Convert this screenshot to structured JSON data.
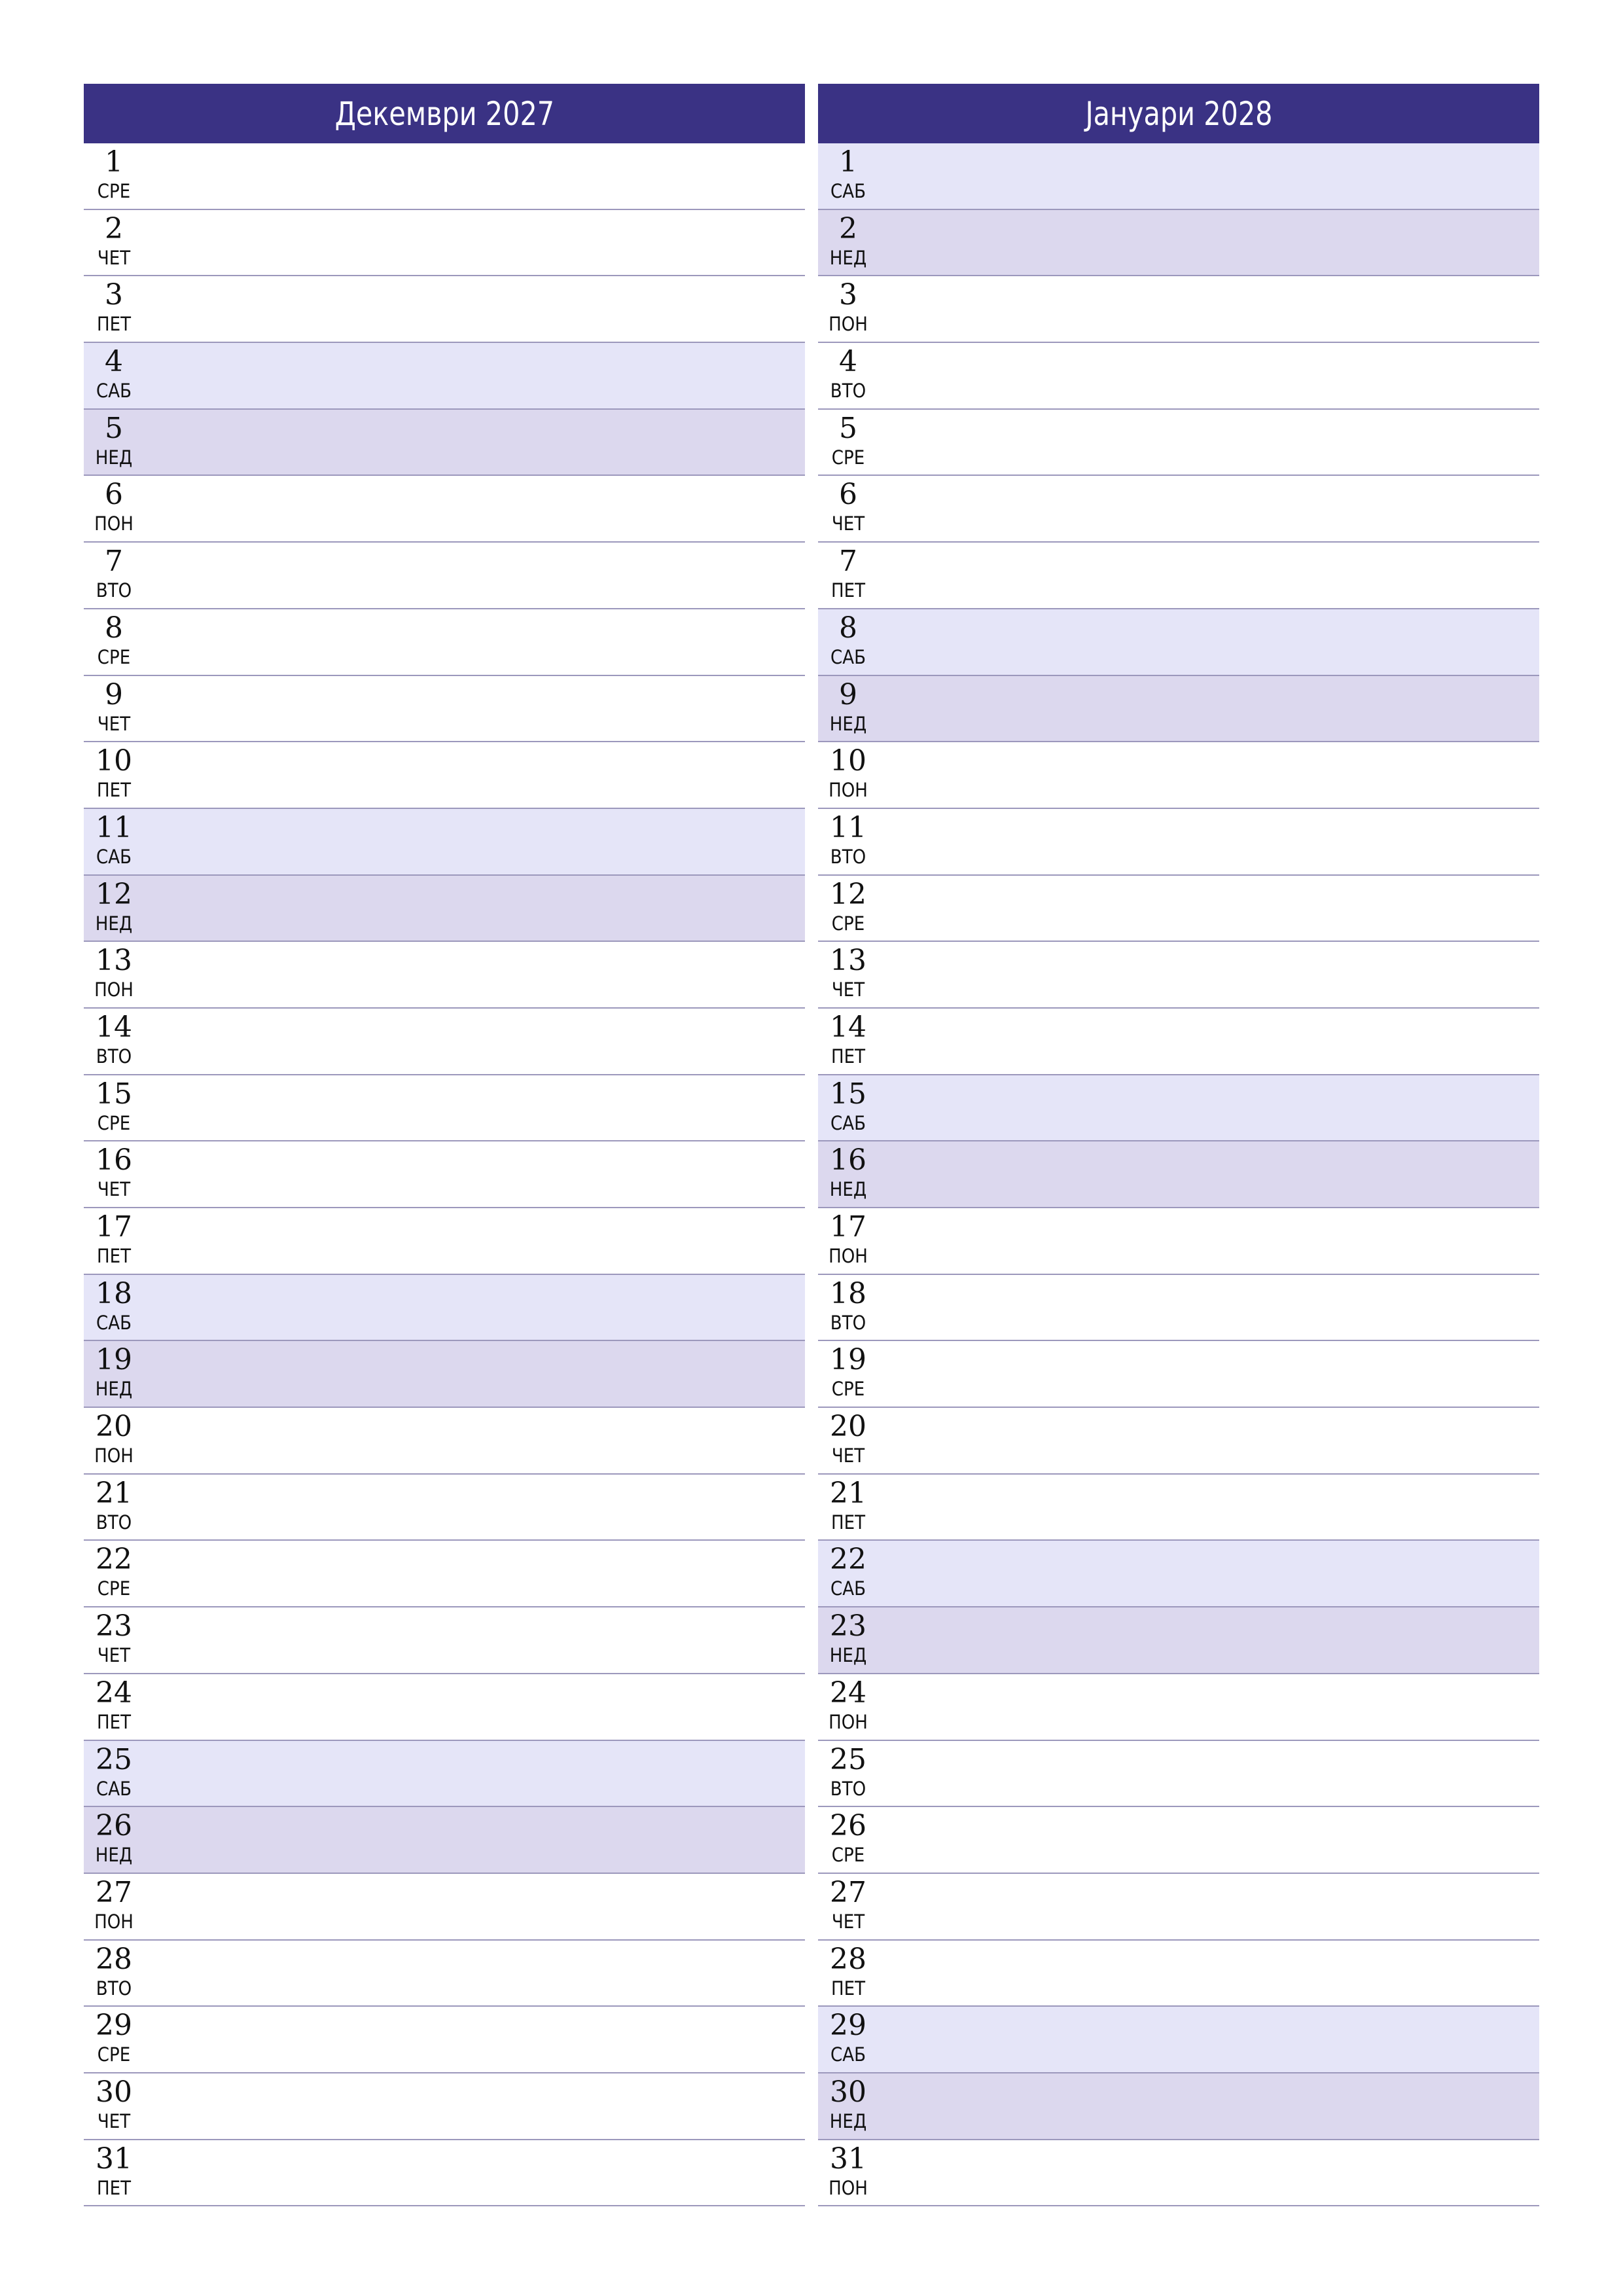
{
  "colors": {
    "header_bg": "#3A3284",
    "saturday_bg": "#E5E5F8",
    "sunday_bg": "#DCD8EE",
    "separator": "#9C98BC"
  },
  "months": [
    {
      "title": "Декември 2027",
      "days": [
        {
          "num": "1",
          "wd": "СРЕ",
          "type": "weekday"
        },
        {
          "num": "2",
          "wd": "ЧЕТ",
          "type": "weekday"
        },
        {
          "num": "3",
          "wd": "ПЕТ",
          "type": "weekday"
        },
        {
          "num": "4",
          "wd": "САБ",
          "type": "sat"
        },
        {
          "num": "5",
          "wd": "НЕД",
          "type": "sun"
        },
        {
          "num": "6",
          "wd": "ПОН",
          "type": "weekday"
        },
        {
          "num": "7",
          "wd": "ВТО",
          "type": "weekday"
        },
        {
          "num": "8",
          "wd": "СРЕ",
          "type": "weekday"
        },
        {
          "num": "9",
          "wd": "ЧЕТ",
          "type": "weekday"
        },
        {
          "num": "10",
          "wd": "ПЕТ",
          "type": "weekday"
        },
        {
          "num": "11",
          "wd": "САБ",
          "type": "sat"
        },
        {
          "num": "12",
          "wd": "НЕД",
          "type": "sun"
        },
        {
          "num": "13",
          "wd": "ПОН",
          "type": "weekday"
        },
        {
          "num": "14",
          "wd": "ВТО",
          "type": "weekday"
        },
        {
          "num": "15",
          "wd": "СРЕ",
          "type": "weekday"
        },
        {
          "num": "16",
          "wd": "ЧЕТ",
          "type": "weekday"
        },
        {
          "num": "17",
          "wd": "ПЕТ",
          "type": "weekday"
        },
        {
          "num": "18",
          "wd": "САБ",
          "type": "sat"
        },
        {
          "num": "19",
          "wd": "НЕД",
          "type": "sun"
        },
        {
          "num": "20",
          "wd": "ПОН",
          "type": "weekday"
        },
        {
          "num": "21",
          "wd": "ВТО",
          "type": "weekday"
        },
        {
          "num": "22",
          "wd": "СРЕ",
          "type": "weekday"
        },
        {
          "num": "23",
          "wd": "ЧЕТ",
          "type": "weekday"
        },
        {
          "num": "24",
          "wd": "ПЕТ",
          "type": "weekday"
        },
        {
          "num": "25",
          "wd": "САБ",
          "type": "sat"
        },
        {
          "num": "26",
          "wd": "НЕД",
          "type": "sun"
        },
        {
          "num": "27",
          "wd": "ПОН",
          "type": "weekday"
        },
        {
          "num": "28",
          "wd": "ВТО",
          "type": "weekday"
        },
        {
          "num": "29",
          "wd": "СРЕ",
          "type": "weekday"
        },
        {
          "num": "30",
          "wd": "ЧЕТ",
          "type": "weekday"
        },
        {
          "num": "31",
          "wd": "ПЕТ",
          "type": "weekday"
        }
      ]
    },
    {
      "title": "Јануари 2028",
      "days": [
        {
          "num": "1",
          "wd": "САБ",
          "type": "sat"
        },
        {
          "num": "2",
          "wd": "НЕД",
          "type": "sun"
        },
        {
          "num": "3",
          "wd": "ПОН",
          "type": "weekday"
        },
        {
          "num": "4",
          "wd": "ВТО",
          "type": "weekday"
        },
        {
          "num": "5",
          "wd": "СРЕ",
          "type": "weekday"
        },
        {
          "num": "6",
          "wd": "ЧЕТ",
          "type": "weekday"
        },
        {
          "num": "7",
          "wd": "ПЕТ",
          "type": "weekday"
        },
        {
          "num": "8",
          "wd": "САБ",
          "type": "sat"
        },
        {
          "num": "9",
          "wd": "НЕД",
          "type": "sun"
        },
        {
          "num": "10",
          "wd": "ПОН",
          "type": "weekday"
        },
        {
          "num": "11",
          "wd": "ВТО",
          "type": "weekday"
        },
        {
          "num": "12",
          "wd": "СРЕ",
          "type": "weekday"
        },
        {
          "num": "13",
          "wd": "ЧЕТ",
          "type": "weekday"
        },
        {
          "num": "14",
          "wd": "ПЕТ",
          "type": "weekday"
        },
        {
          "num": "15",
          "wd": "САБ",
          "type": "sat"
        },
        {
          "num": "16",
          "wd": "НЕД",
          "type": "sun"
        },
        {
          "num": "17",
          "wd": "ПОН",
          "type": "weekday"
        },
        {
          "num": "18",
          "wd": "ВТО",
          "type": "weekday"
        },
        {
          "num": "19",
          "wd": "СРЕ",
          "type": "weekday"
        },
        {
          "num": "20",
          "wd": "ЧЕТ",
          "type": "weekday"
        },
        {
          "num": "21",
          "wd": "ПЕТ",
          "type": "weekday"
        },
        {
          "num": "22",
          "wd": "САБ",
          "type": "sat"
        },
        {
          "num": "23",
          "wd": "НЕД",
          "type": "sun"
        },
        {
          "num": "24",
          "wd": "ПОН",
          "type": "weekday"
        },
        {
          "num": "25",
          "wd": "ВТО",
          "type": "weekday"
        },
        {
          "num": "26",
          "wd": "СРЕ",
          "type": "weekday"
        },
        {
          "num": "27",
          "wd": "ЧЕТ",
          "type": "weekday"
        },
        {
          "num": "28",
          "wd": "ПЕТ",
          "type": "weekday"
        },
        {
          "num": "29",
          "wd": "САБ",
          "type": "sat"
        },
        {
          "num": "30",
          "wd": "НЕД",
          "type": "sun"
        },
        {
          "num": "31",
          "wd": "ПОН",
          "type": "weekday"
        }
      ]
    }
  ]
}
